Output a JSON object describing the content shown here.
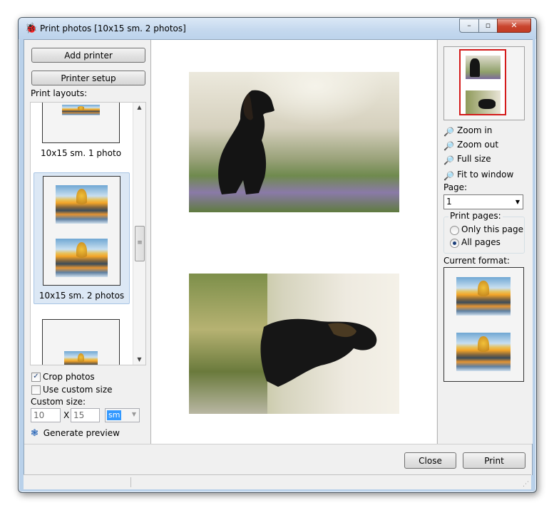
{
  "window": {
    "title": "Print photos  [10x15 sm. 2 photos]",
    "controls": {
      "minimize": "–",
      "maximize": "▫",
      "close": "✕"
    }
  },
  "left": {
    "add_printer": "Add printer",
    "printer_setup": "Printer setup",
    "layouts_label": "Print layouts:",
    "layouts": [
      {
        "caption": "10x15 sm. 1 photo",
        "selected": false
      },
      {
        "caption": "10x15 sm. 2 photos",
        "selected": true
      }
    ],
    "crop_photos": {
      "label": "Crop photos",
      "checked": true
    },
    "use_custom_size": {
      "label": "Use custom size",
      "checked": false
    },
    "custom_size_label": "Custom size:",
    "width_value": "10",
    "times_sign": "X",
    "height_value": "15",
    "unit_value": "sm",
    "generate_preview": "Generate preview"
  },
  "right": {
    "zoom_in": "Zoom in",
    "zoom_out": "Zoom out",
    "full_size": "Full size",
    "fit_to_window": "Fit to window",
    "page_label": "Page:",
    "page_value": "1",
    "print_pages_label": "Print pages:",
    "only_this_page": {
      "label": "Only this page",
      "selected": false
    },
    "all_pages": {
      "label": "All pages",
      "selected": true
    },
    "current_format_label": "Current format:"
  },
  "bottom": {
    "close": "Close",
    "print": "Print"
  },
  "colors": {
    "title_bar": "#c4d8ee",
    "close_button": "#c9452e",
    "selection_highlight": "#dce8f5",
    "thumbnail_frame": "#d41a1a"
  },
  "icons": {
    "app": "bug-icon",
    "zoom": "magnifier-icon",
    "generate": "paw-icon"
  }
}
